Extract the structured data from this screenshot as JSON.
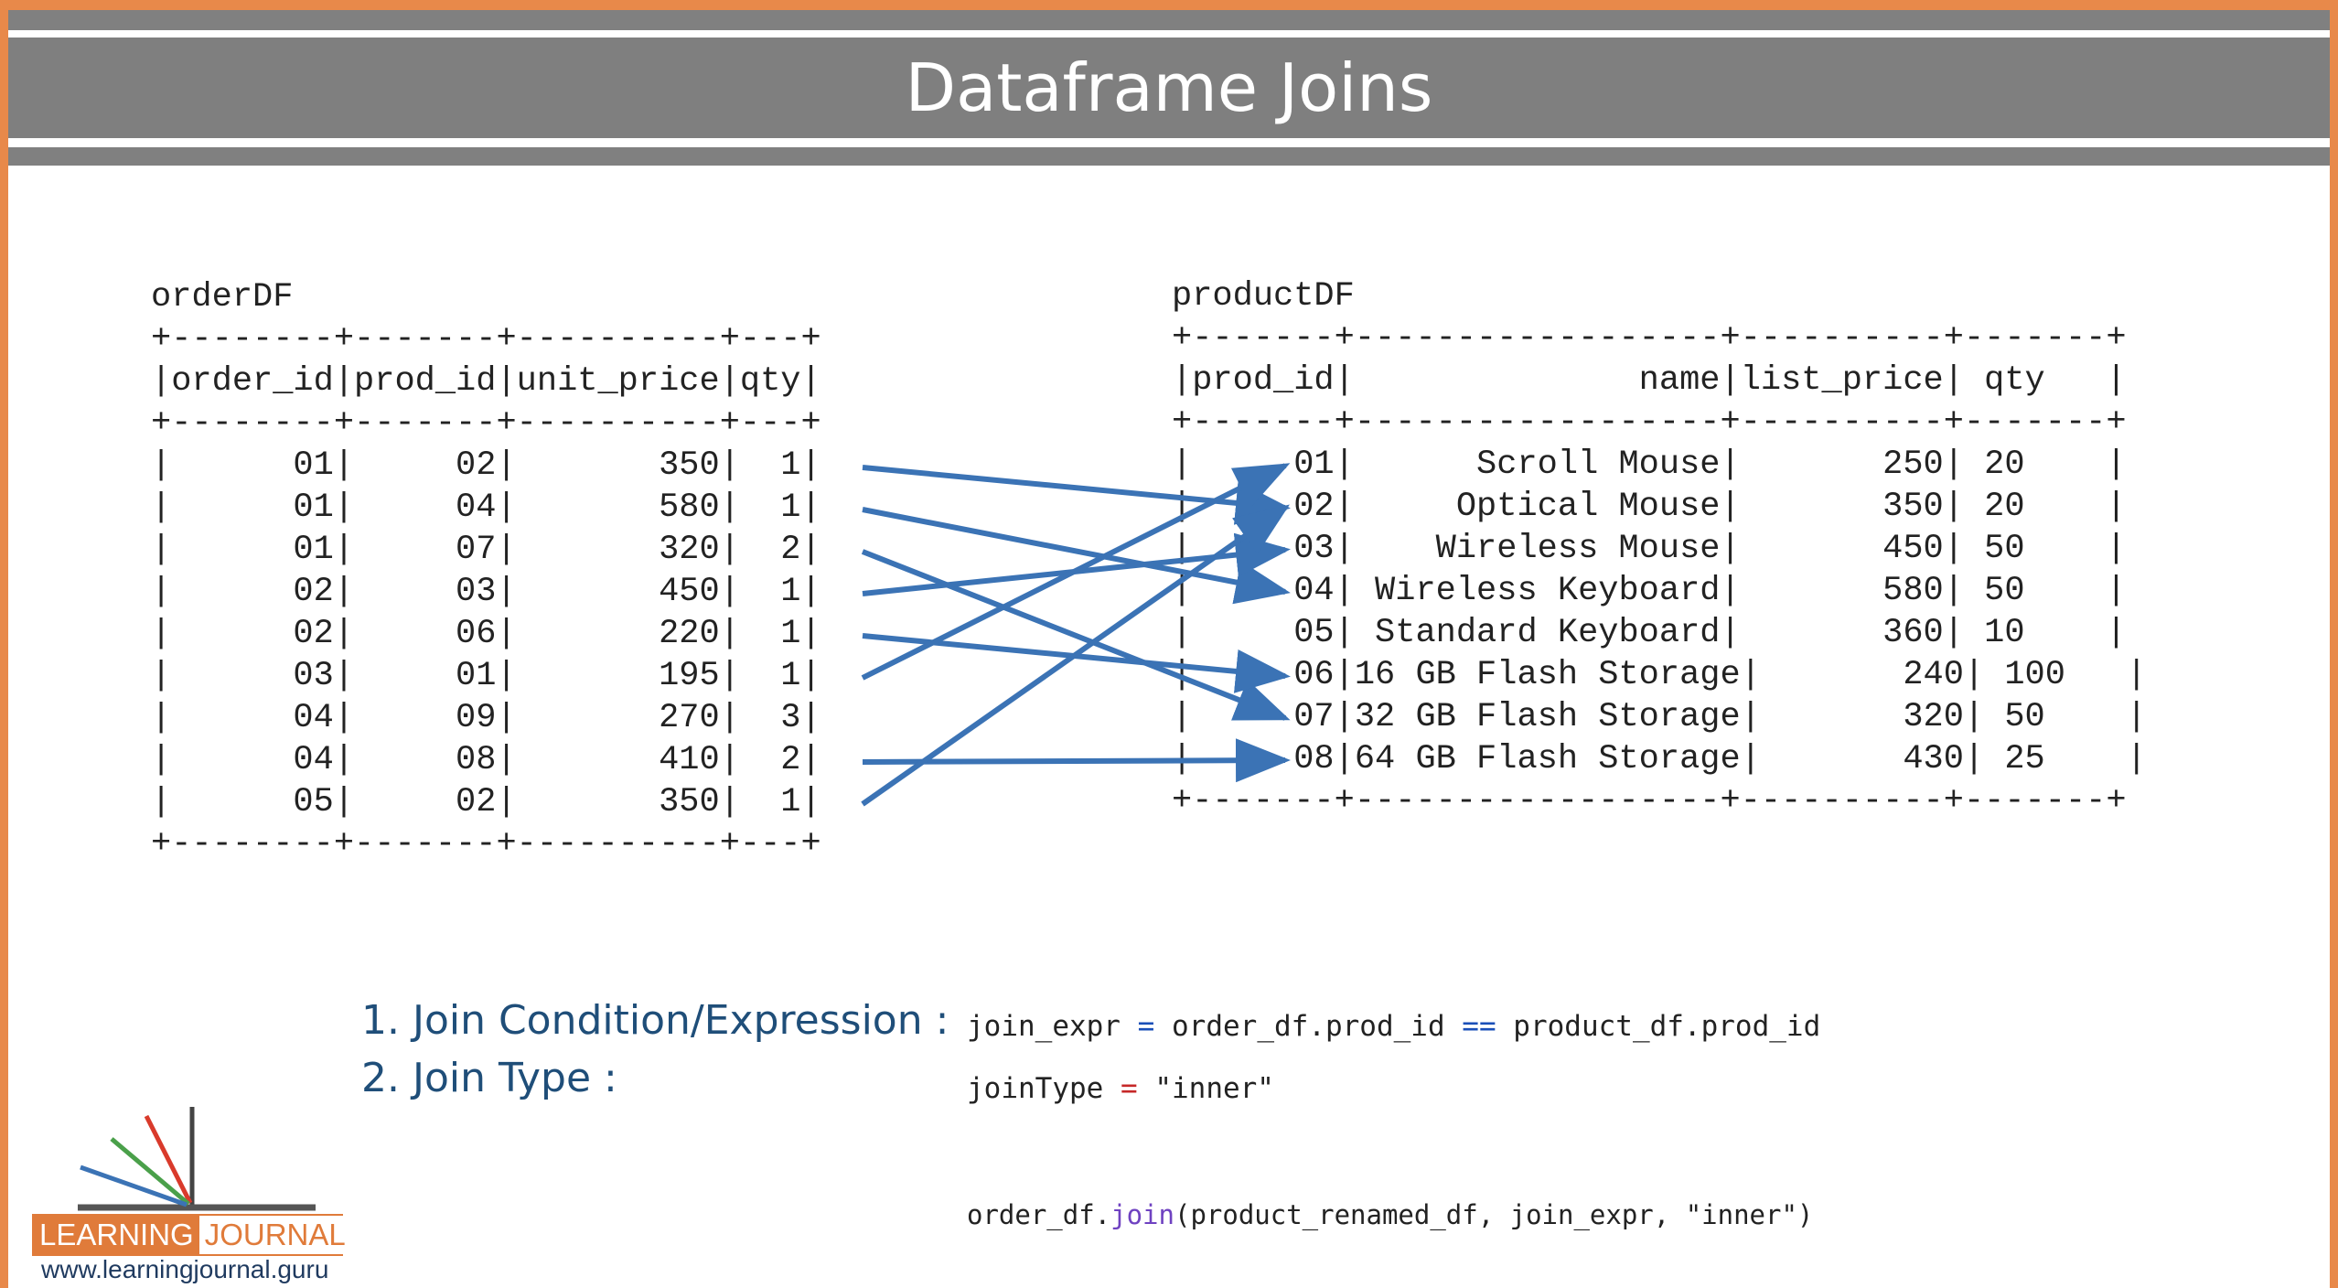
{
  "title": "Dataframe Joins",
  "order_df": {
    "name": "orderDF",
    "table_text": "+--------+-------+----------+---+\n|order_id|prod_id|unit_price|qty|\n+--------+-------+----------+---+\n|      01|     02|       350|  1|\n|      01|     04|       580|  1|\n|      01|     07|       320|  2|\n|      02|     03|       450|  1|\n|      02|     06|       220|  1|\n|      03|     01|       195|  1|\n|      04|     09|       270|  3|\n|      04|     08|       410|  2|\n|      05|     02|       350|  1|\n+--------+-------+----------+---+",
    "columns": [
      "order_id",
      "prod_id",
      "unit_price",
      "qty"
    ],
    "rows": [
      [
        "01",
        "02",
        "350",
        "1"
      ],
      [
        "01",
        "04",
        "580",
        "1"
      ],
      [
        "01",
        "07",
        "320",
        "2"
      ],
      [
        "02",
        "03",
        "450",
        "1"
      ],
      [
        "02",
        "06",
        "220",
        "1"
      ],
      [
        "03",
        "01",
        "195",
        "1"
      ],
      [
        "04",
        "09",
        "270",
        "3"
      ],
      [
        "04",
        "08",
        "410",
        "2"
      ],
      [
        "05",
        "02",
        "350",
        "1"
      ]
    ]
  },
  "product_df": {
    "name": "productDF",
    "table_text": "+-------+------------------+----------+-------+\n|prod_id|              name|list_price| qty   |\n+-------+------------------+----------+-------+\n|     01|      Scroll Mouse|       250| 20    |\n|     02|     Optical Mouse|       350| 20    |\n|     03|    Wireless Mouse|       450| 50    |\n|     04| Wireless Keyboard|       580| 50    |\n|     05| Standard Keyboard|       360| 10    |\n|     06|16 GB Flash Storage|       240| 100   |\n|     07|32 GB Flash Storage|       320| 50    |\n|     08|64 GB Flash Storage|       430| 25    |\n+-------+------------------+----------+-------+",
    "columns": [
      "prod_id",
      "name",
      "list_price",
      "qty"
    ],
    "rows": [
      [
        "01",
        "Scroll Mouse",
        "250",
        "20"
      ],
      [
        "02",
        "Optical Mouse",
        "350",
        "20"
      ],
      [
        "03",
        "Wireless Mouse",
        "450",
        "50"
      ],
      [
        "04",
        "Wireless Keyboard",
        "580",
        "50"
      ],
      [
        "05",
        "Standard Keyboard",
        "360",
        "10"
      ],
      [
        "06",
        "16 GB Flash Storage",
        "240",
        "100"
      ],
      [
        "07",
        "32 GB Flash Storage",
        "320",
        "50"
      ],
      [
        "08",
        "64 GB Flash Storage",
        "430",
        "25"
      ]
    ]
  },
  "join_arrows": [
    {
      "from_order_row": 1,
      "to_product_row": 2
    },
    {
      "from_order_row": 2,
      "to_product_row": 4
    },
    {
      "from_order_row": 3,
      "to_product_row": 7
    },
    {
      "from_order_row": 4,
      "to_product_row": 3
    },
    {
      "from_order_row": 5,
      "to_product_row": 6
    },
    {
      "from_order_row": 6,
      "to_product_row": 1
    },
    {
      "from_order_row": 8,
      "to_product_row": 8
    },
    {
      "from_order_row": 9,
      "to_product_row": 2
    }
  ],
  "labels": {
    "join_condition": "1. Join Condition/Expression :",
    "join_type": "2. Join Type :"
  },
  "code": {
    "expr_lhs": "join_expr",
    "expr_eq": "=",
    "expr_left_col": "order_df.prod_id",
    "expr_op": "==",
    "expr_right_col": "product_df.prod_id",
    "type_lhs": "joinType",
    "type_eq": "=",
    "type_value": "\"inner\"",
    "call_obj": "order_df.",
    "call_method": "join",
    "call_args": "(product_renamed_df, join_expr, \"inner\")"
  },
  "logo": {
    "left": "LEARNING",
    "right": "JOURNAL",
    "url": "www.learningjournal.guru"
  },
  "colors": {
    "frame": "#e8894a",
    "header_band": "#7f7f7f",
    "arrow": "#3b73b5",
    "label_text": "#1f4e79"
  }
}
